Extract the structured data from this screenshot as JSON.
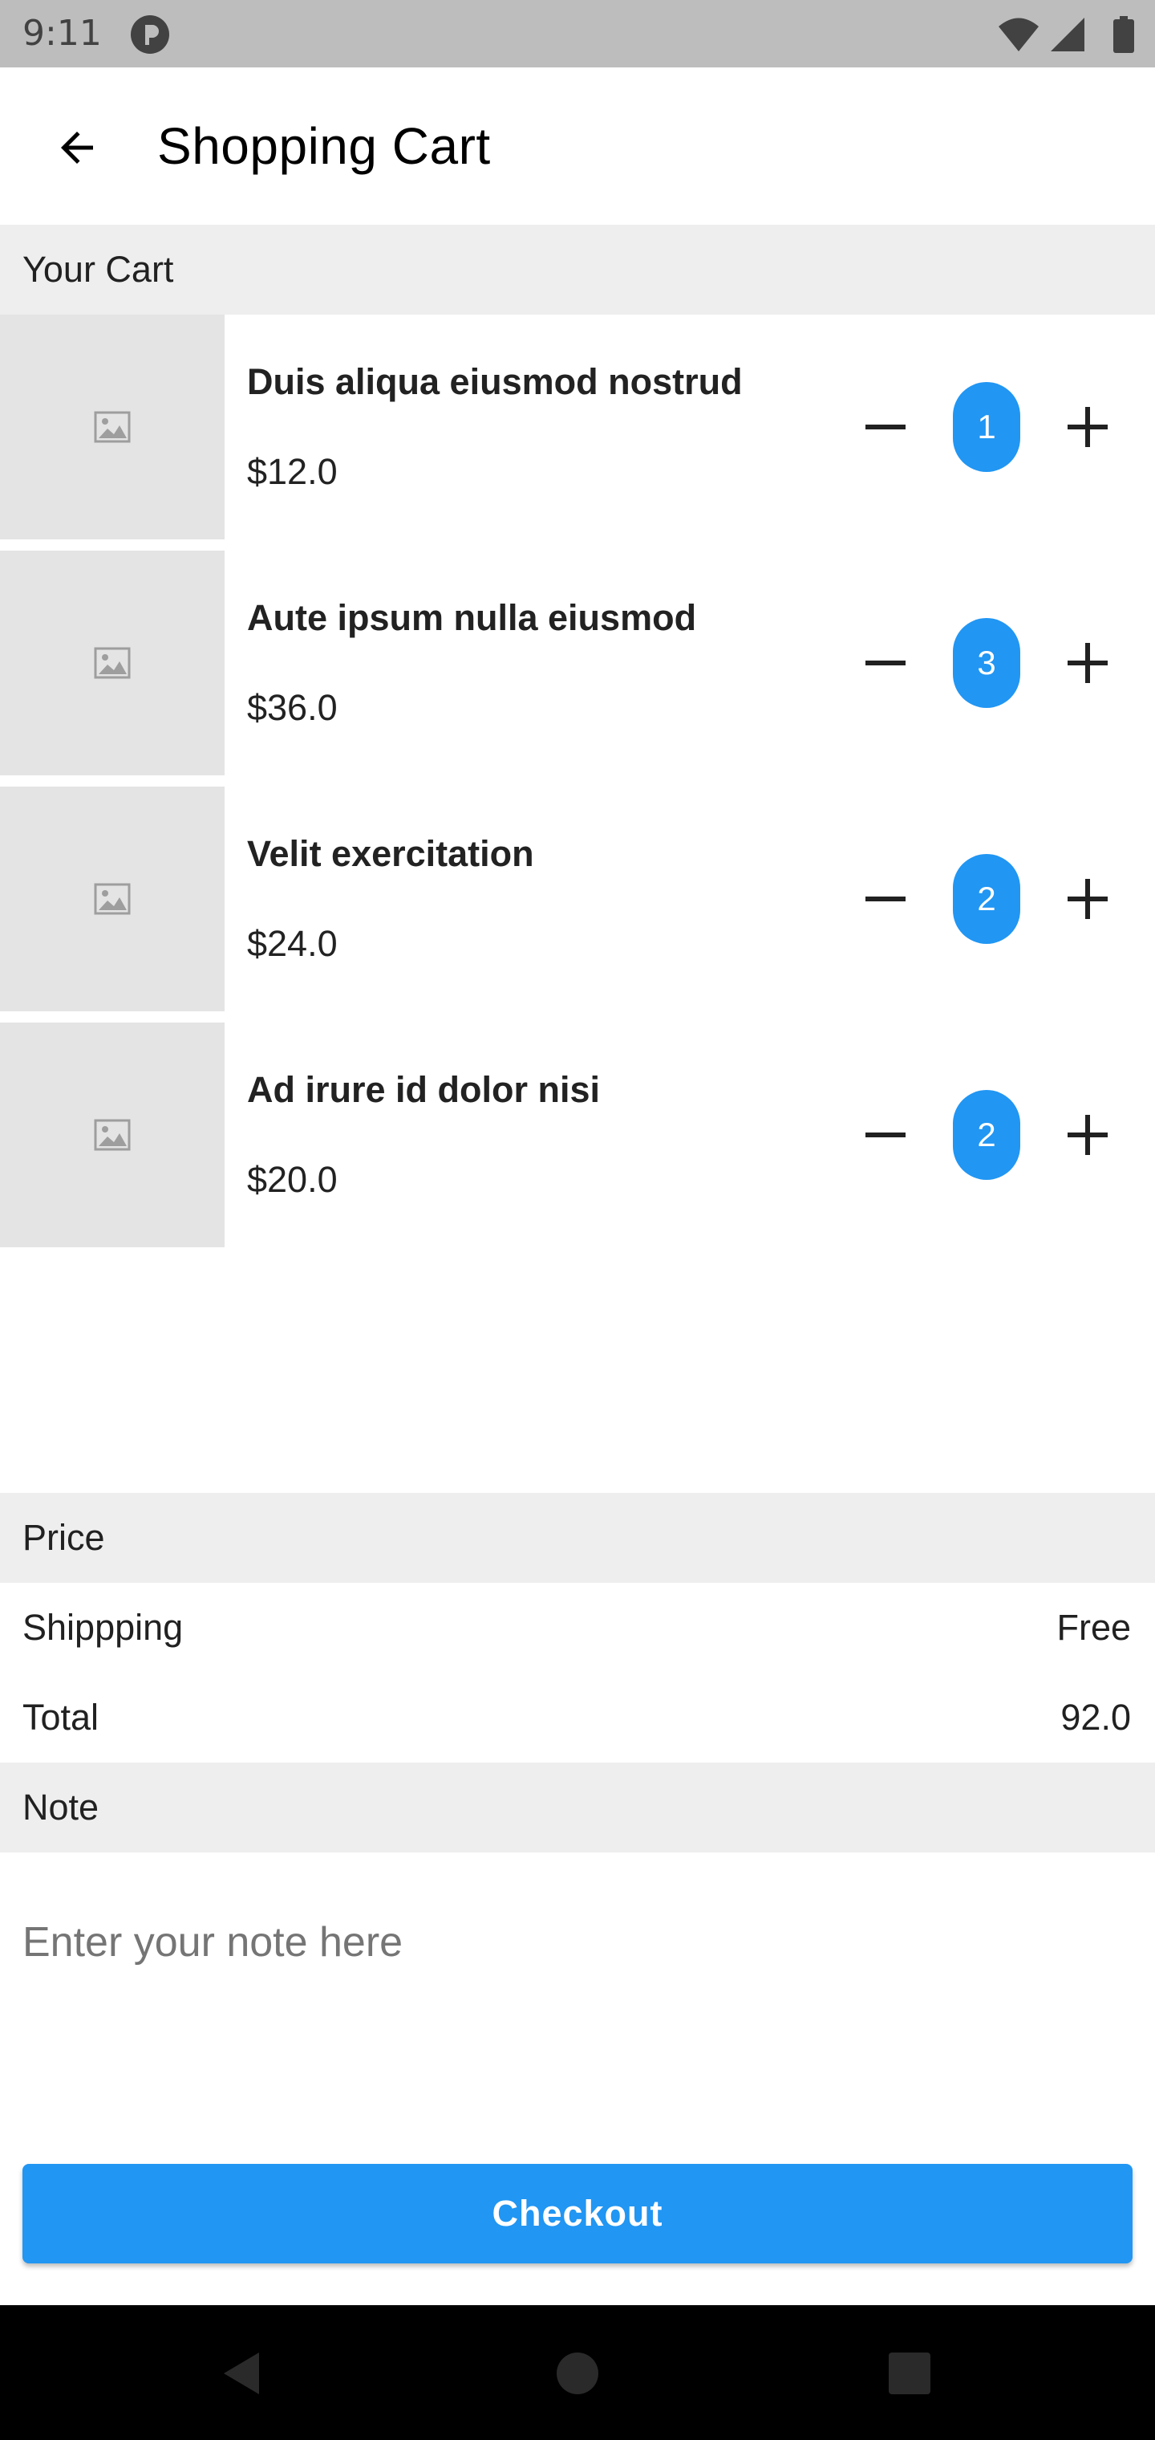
{
  "status_bar": {
    "time": "9:11"
  },
  "app_bar": {
    "title": "Shopping Cart"
  },
  "cart_section": {
    "header": "Your Cart"
  },
  "cart_items": [
    {
      "name": "Duis aliqua eiusmod nostrud",
      "price": "$12.0",
      "quantity": "1"
    },
    {
      "name": "Aute ipsum nulla eiusmod",
      "price": "$36.0",
      "quantity": "3"
    },
    {
      "name": "Velit exercitation",
      "price": "$24.0",
      "quantity": "2"
    },
    {
      "name": "Ad irure id dolor nisi",
      "price": "$20.0",
      "quantity": "2"
    }
  ],
  "price_section": {
    "header": "Price",
    "shipping_label": "Shippping",
    "shipping_value": "Free",
    "total_label": "Total",
    "total_value": "92.0"
  },
  "note_section": {
    "header": "Note",
    "placeholder": "Enter your note here",
    "value": ""
  },
  "checkout": {
    "label": "Checkout"
  },
  "icons": {
    "back": "arrow-left-icon",
    "thumbnail": "image-placeholder-icon",
    "decrement": "minus-icon",
    "increment": "plus-icon",
    "nav_back": "triangle-back-icon",
    "nav_home": "circle-home-icon",
    "nav_recents": "square-recents-icon"
  },
  "colors": {
    "accent": "#2196f3",
    "section_header_bg": "#eeeeee",
    "thumbnail_bg": "#e4e4e4",
    "status_bar_bg": "#bdbdbd",
    "nav_bar_bg": "#000000"
  }
}
